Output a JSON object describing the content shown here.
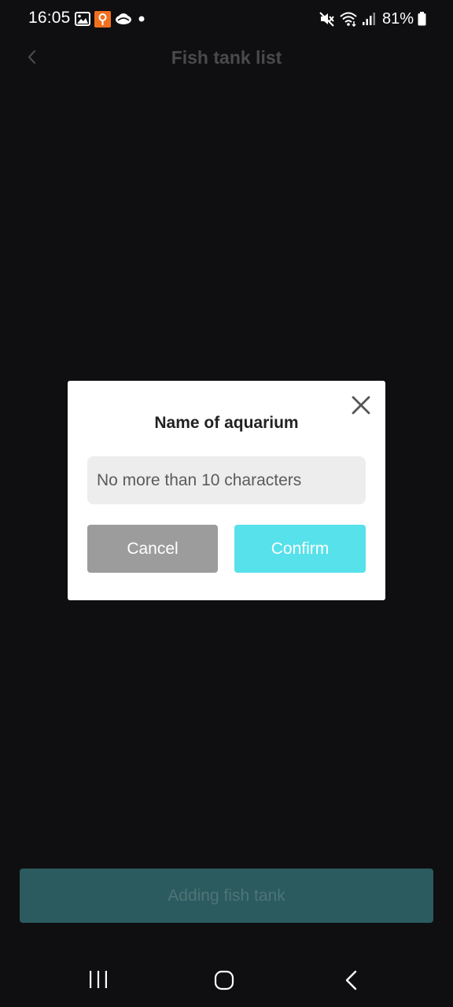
{
  "status_bar": {
    "time": "16:05",
    "battery": "81%",
    "icons": [
      "gallery-icon",
      "app-notification-icon",
      "cloud-icon",
      "dot-icon",
      "mute-icon",
      "wifi-icon",
      "signal-icon",
      "battery-icon"
    ]
  },
  "header": {
    "title": "Fish tank list",
    "back_icon": "chevron-left-icon"
  },
  "dialog": {
    "title": "Name of aquarium",
    "input_placeholder": "No more than 10 characters",
    "input_value": "",
    "cancel_label": "Cancel",
    "confirm_label": "Confirm",
    "close_icon": "close-icon"
  },
  "footer": {
    "add_button_label": "Adding fish tank"
  },
  "colors": {
    "background": "#0f0f11",
    "confirm": "#57e1ea",
    "cancel": "#9c9c9c",
    "add_button": "#2b5b5e"
  }
}
